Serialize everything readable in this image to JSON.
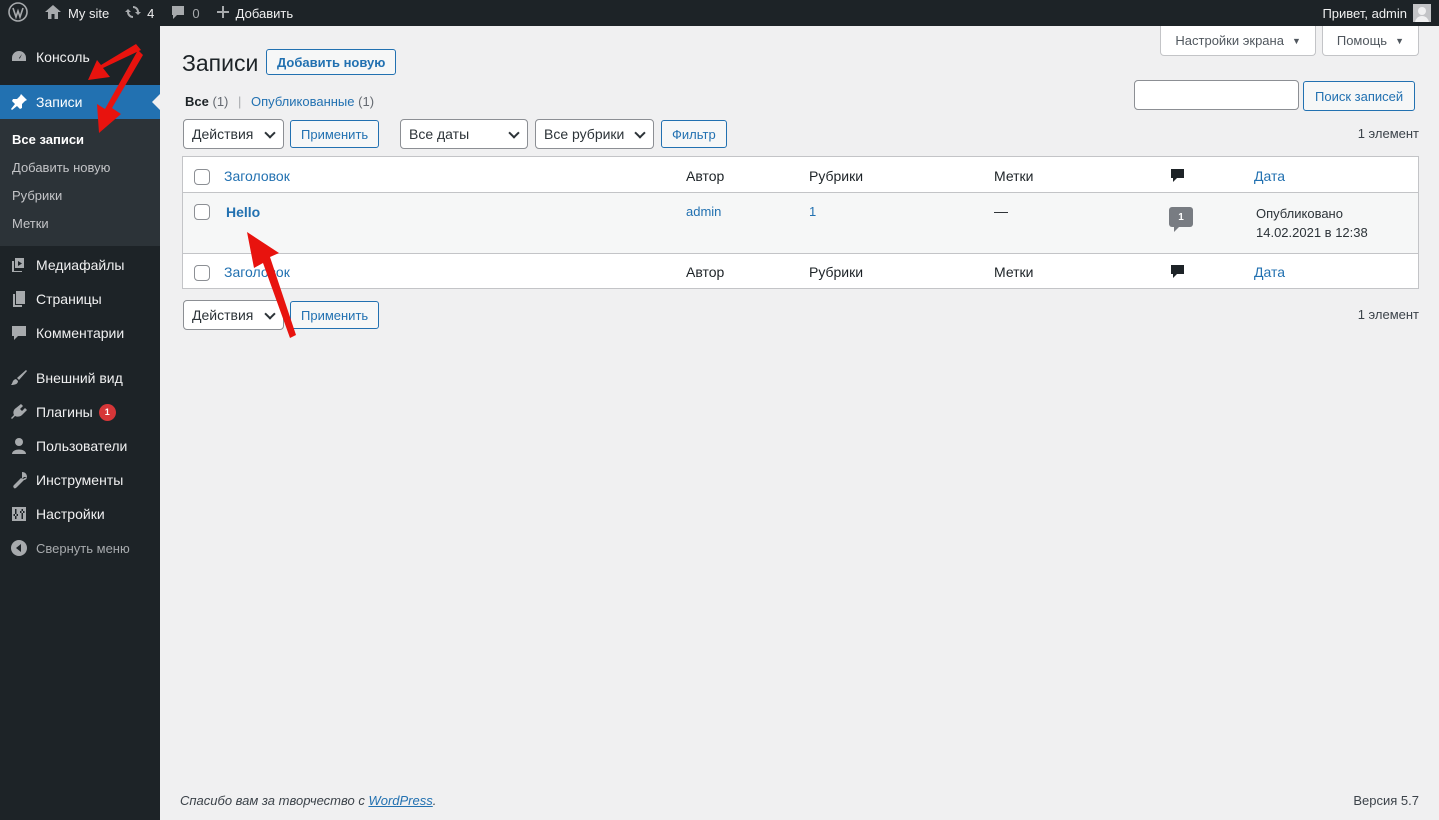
{
  "adminbar": {
    "site_name": "My site",
    "updates_count": "4",
    "comments_count": "0",
    "add_new": "Добавить",
    "greeting": "Привет, admin"
  },
  "sidebar": {
    "items": [
      {
        "label": "Консоль",
        "icon": "dashboard-icon"
      },
      {
        "label": "Записи",
        "icon": "pin-icon"
      },
      {
        "label": "Медиафайлы",
        "icon": "media-icon"
      },
      {
        "label": "Страницы",
        "icon": "pages-icon"
      },
      {
        "label": "Комментарии",
        "icon": "comment-icon"
      },
      {
        "label": "Внешний вид",
        "icon": "brush-icon"
      },
      {
        "label": "Плагины",
        "icon": "plugin-icon",
        "badge": "1"
      },
      {
        "label": "Пользователи",
        "icon": "user-icon"
      },
      {
        "label": "Инструменты",
        "icon": "wrench-icon"
      },
      {
        "label": "Настройки",
        "icon": "settings-icon"
      }
    ],
    "submenu": [
      "Все записи",
      "Добавить новую",
      "Рубрики",
      "Метки"
    ],
    "collapse": "Свернуть меню"
  },
  "screen_tabs": {
    "screen_options": "Настройки экрана",
    "help": "Помощь"
  },
  "page": {
    "title": "Записи",
    "add_new": "Добавить новую"
  },
  "filters": {
    "all_label": "Все",
    "all_count": "(1)",
    "published_label": "Опубликованные",
    "published_count": "(1)",
    "search_button": "Поиск записей",
    "bulk_actions": "Действия",
    "apply": "Применить",
    "all_dates": "Все даты",
    "all_categories": "Все рубрики",
    "filter": "Фильтр",
    "items_count": "1 элемент"
  },
  "table": {
    "columns": {
      "title": "Заголовок",
      "author": "Автор",
      "categories": "Рубрики",
      "tags": "Метки",
      "date": "Дата"
    },
    "rows": [
      {
        "title": "Hello",
        "author": "admin",
        "categories": "1",
        "tags": "—",
        "comments": "1",
        "date_status": "Опубликовано",
        "date_value": "14.02.2021 в 12:38"
      }
    ]
  },
  "footer": {
    "thanks_prefix": "Спасибо вам за творчество с ",
    "wp_link": "WordPress",
    "thanks_suffix": ".",
    "version": "Версия 5.7"
  },
  "colors": {
    "accent": "#2271b1",
    "sidebar_bg": "#1d2327",
    "annotation": "#e8130e"
  }
}
